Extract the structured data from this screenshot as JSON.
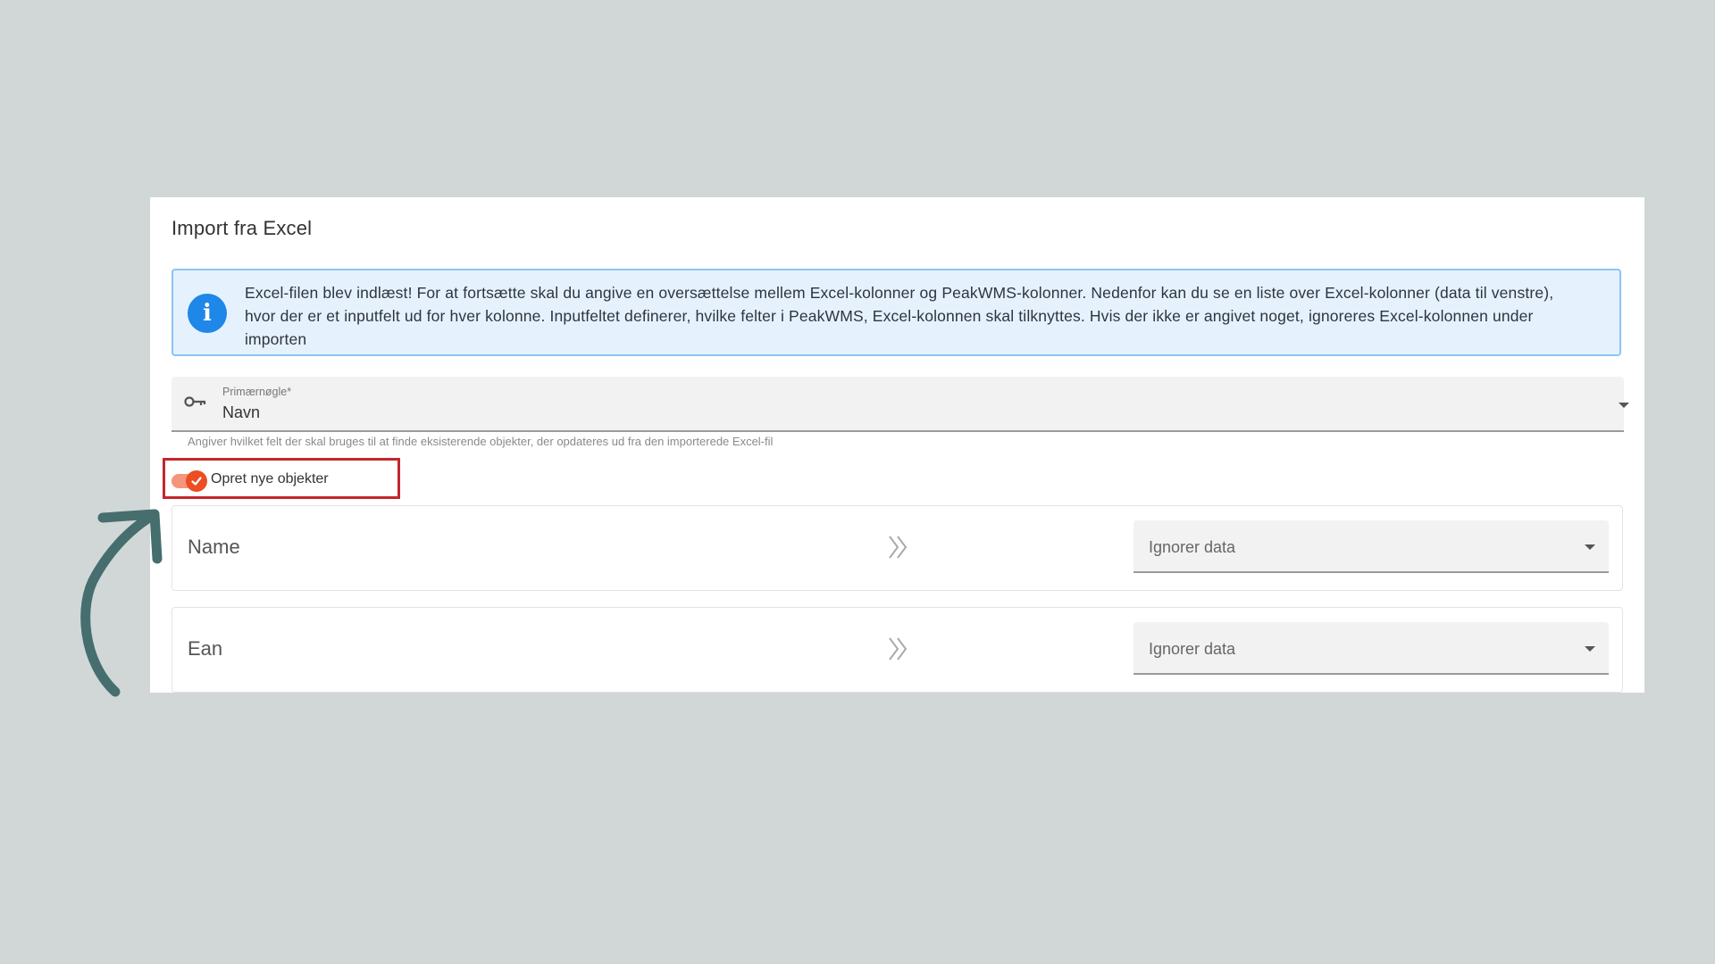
{
  "dialog": {
    "title": "Import fra Excel",
    "info": "Excel-filen blev indlæst! For at fortsætte skal du angive en oversættelse mellem Excel-kolonner og PeakWMS-kolonner. Nedenfor kan du se en liste over Excel-kolonner (data til venstre), hvor der er et inputfelt ud for hver kolonne. Inputfeltet definerer, hvilke felter i PeakWMS, Excel-kolonnen skal tilknyttes. Hvis der ikke er angivet noget, ignoreres Excel-kolonnen under importen",
    "info_icon": "info-icon"
  },
  "primary_key": {
    "label": "Primærnøgle*",
    "value": "Navn",
    "helper": "Angiver hvilket felt der skal bruges til at finde eksisterende objekter, der opdateres ud fra den importerede Excel-fil",
    "icon": "key-icon"
  },
  "create_toggle": {
    "label": "Opret nye objekter",
    "checked": true,
    "color": "#ea4e22"
  },
  "mappings": [
    {
      "column": "Name",
      "target": "Ignorer data"
    },
    {
      "column": "Ean",
      "target": "Ignorer data"
    }
  ],
  "annotation": {
    "highlight_color": "#c3262c",
    "arrow_color": "#466e6e"
  }
}
